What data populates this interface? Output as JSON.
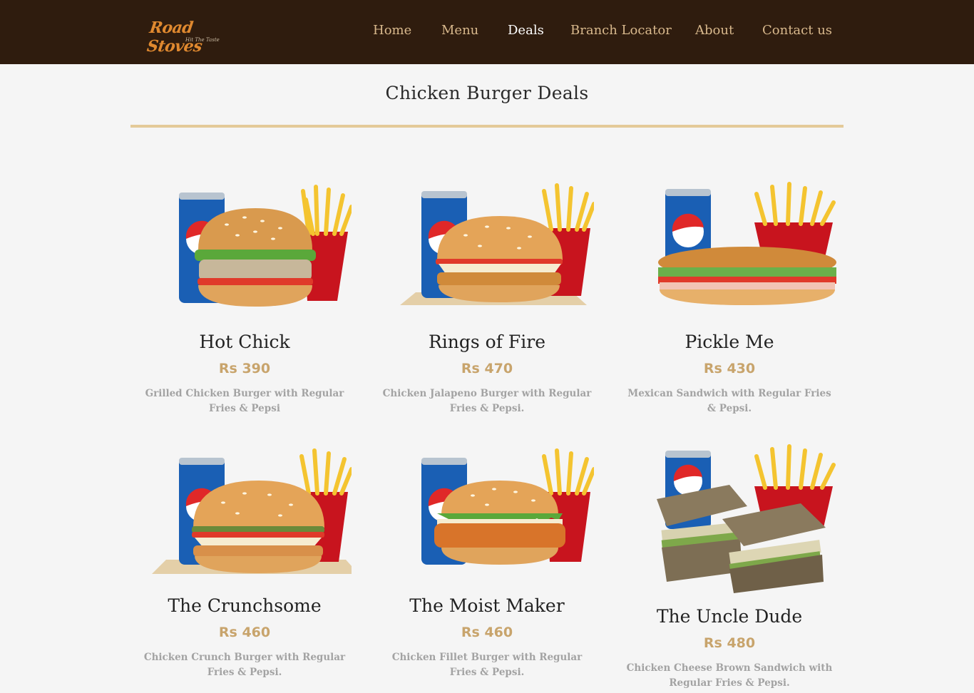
{
  "brand": {
    "name": "Road Stoves",
    "tagline": "Hit The Taste"
  },
  "nav": {
    "items": [
      {
        "label": "Home"
      },
      {
        "label": "Menu"
      },
      {
        "label": "Deals"
      },
      {
        "label": "Branch Locator"
      },
      {
        "label": "About"
      },
      {
        "label": "Contact us"
      }
    ],
    "active": "Deals"
  },
  "page": {
    "title": "Chicken Burger Deals"
  },
  "deals": [
    {
      "name": "Hot Chick",
      "price": "Rs 390",
      "description": "Grilled Chicken Burger with Regular Fries & Pepsi",
      "image": "burger-combo-grilled"
    },
    {
      "name": "Rings of Fire",
      "price": "Rs 470",
      "description": "Chicken Jalapeno Burger with Regular Fries & Pepsi.",
      "image": "burger-combo-jalapeno"
    },
    {
      "name": "Pickle Me",
      "price": "Rs 430",
      "description": "Mexican Sandwich with Regular Fries & Pepsi.",
      "image": "sub-sandwich-combo"
    },
    {
      "name": "The Crunchsome",
      "price": "Rs 460",
      "description": "Chicken Crunch Burger with Regular Fries & Pepsi.",
      "image": "burger-combo-crunch"
    },
    {
      "name": "The Moist Maker",
      "price": "Rs 460",
      "description": "Chicken Fillet Burger with Regular Fries & Pepsi.",
      "image": "burger-combo-fillet"
    },
    {
      "name": "The Uncle Dude",
      "price": "Rs 480",
      "description": "Chicken Cheese Brown Sandwich with Regular Fries & Pepsi.",
      "image": "brown-sandwich-combo"
    }
  ],
  "colors": {
    "navbar": "#2f1c0e",
    "nav_link": "#d8b88c",
    "nav_active": "#ffffff",
    "accent_rule": "#e4ca98",
    "price": "#c8a46c",
    "description": "#a3a3a3"
  }
}
